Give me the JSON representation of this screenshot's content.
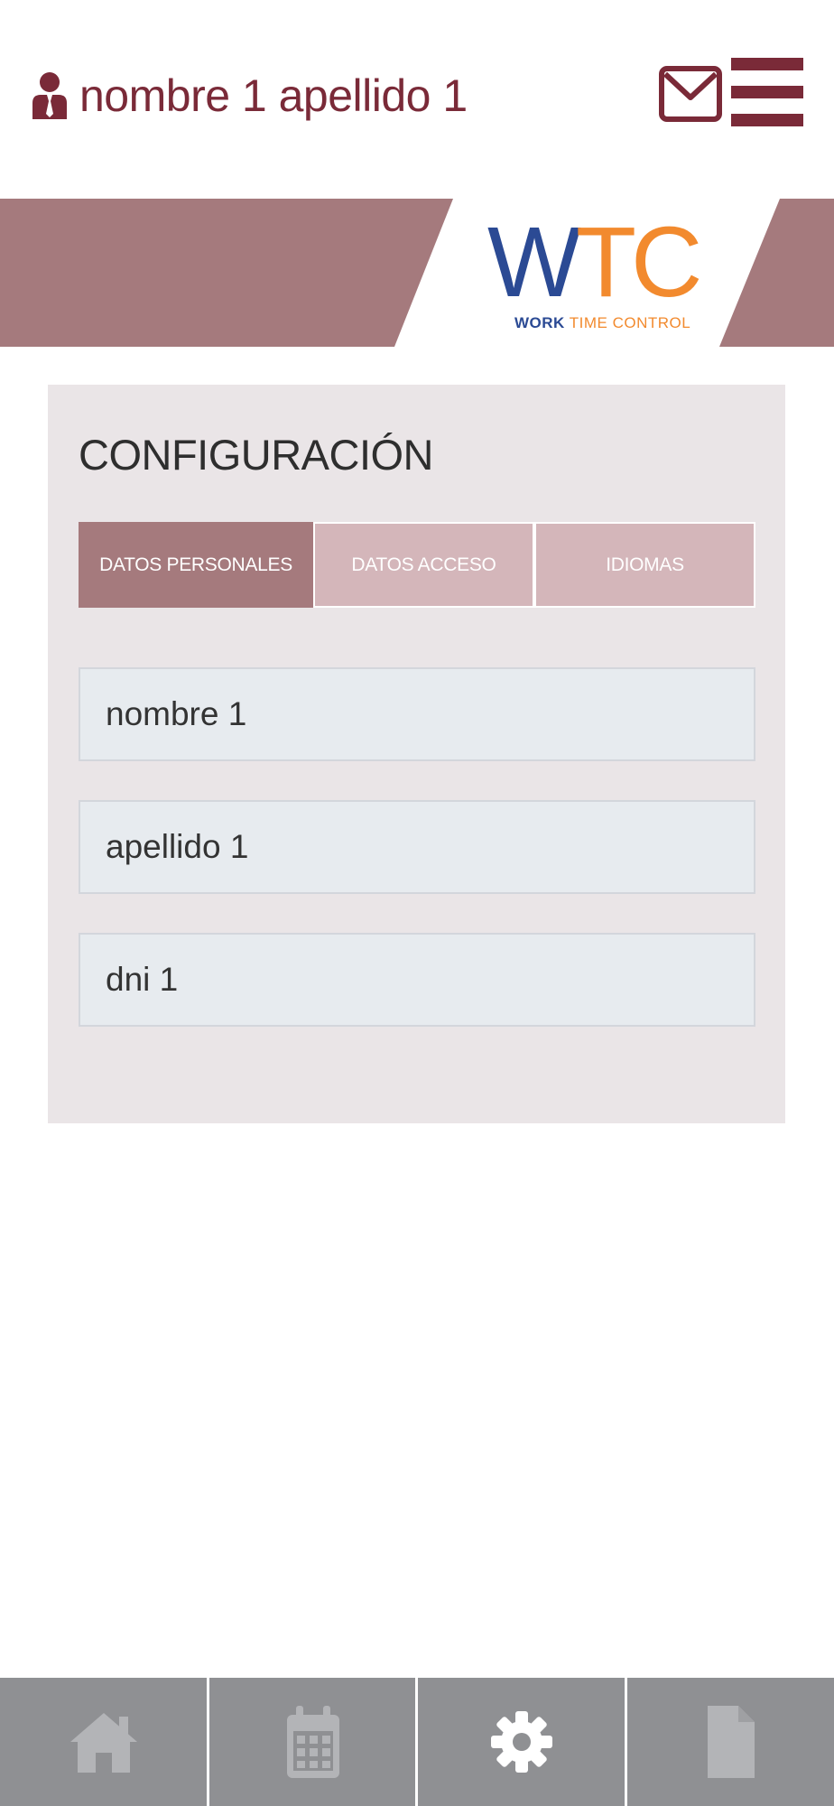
{
  "header": {
    "user_name": "nombre 1 apellido 1",
    "mail_icon": "envelope-icon",
    "menu_icon": "hamburger-menu-icon"
  },
  "logo": {
    "letters_w": "W",
    "letters_tc": "TC",
    "sub_work": "WORK",
    "sub_rest": " TIME CONTROL"
  },
  "config": {
    "title": "CONFIGURACIÓN",
    "tabs": [
      {
        "label": "DATOS PERSONALES",
        "active": true
      },
      {
        "label": "DATOS ACCESO",
        "active": false
      },
      {
        "label": "IDIOMAS",
        "active": false
      }
    ],
    "fields": [
      {
        "value": "nombre 1"
      },
      {
        "value": "apellido 1"
      },
      {
        "value": "dni 1"
      }
    ]
  },
  "bottom_nav": [
    {
      "icon": "home-icon"
    },
    {
      "icon": "calendar-icon"
    },
    {
      "icon": "gear-icon",
      "active": true
    },
    {
      "icon": "document-icon"
    }
  ],
  "colors": {
    "brand": "#7a2a38",
    "banner": "#a57a7d",
    "tab_active": "#a57a7d",
    "tab_inactive": "#d4b6ba",
    "card_bg": "#eae5e7",
    "nav_bg": "#8f9093",
    "logo_blue": "#2b4a94",
    "logo_orange": "#f28a2e"
  }
}
